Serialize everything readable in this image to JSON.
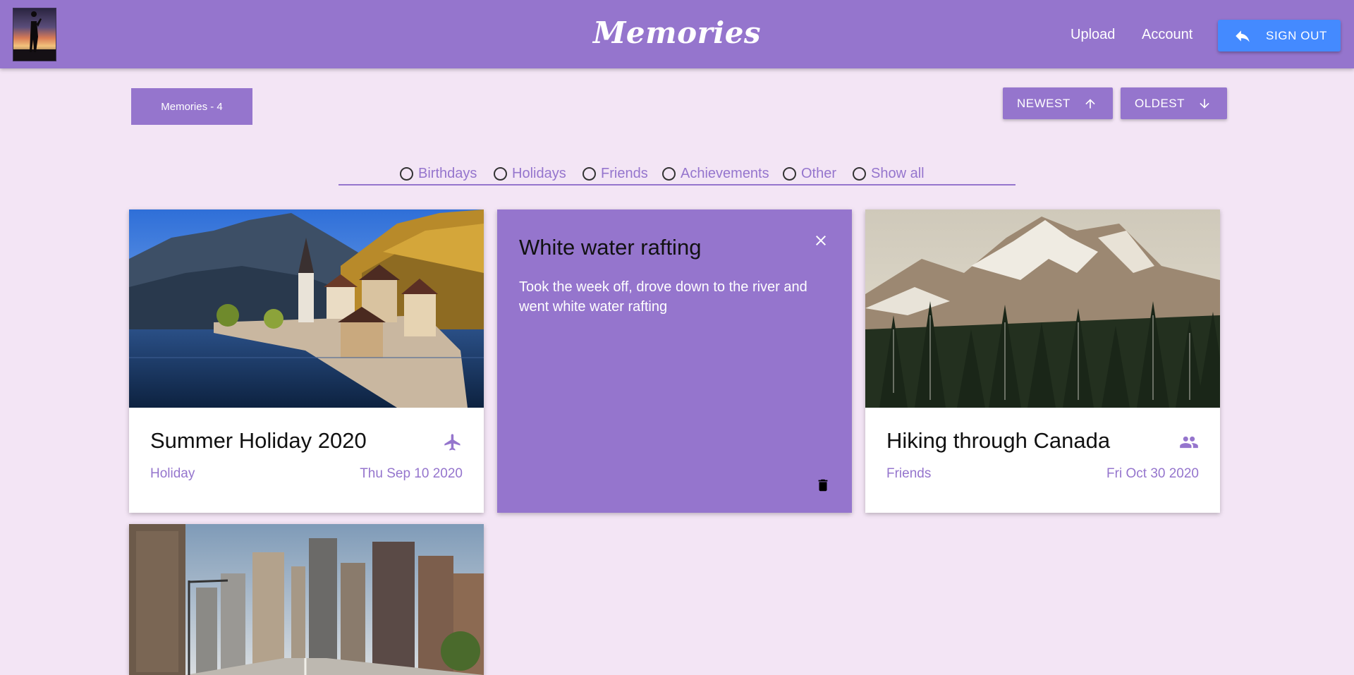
{
  "header": {
    "title": "Memories",
    "nav": {
      "upload": "Upload",
      "account": "Account"
    },
    "sign_out": "SIGN OUT",
    "avatar_alt": "avatar"
  },
  "toolbar": {
    "count_label": "Memories - 4",
    "sort_newest": "NEWEST",
    "sort_oldest": "OLDEST"
  },
  "filters": [
    {
      "label": "Birthdays",
      "checked": false
    },
    {
      "label": "Holidays",
      "checked": false
    },
    {
      "label": "Friends",
      "checked": false
    },
    {
      "label": "Achievements",
      "checked": false
    },
    {
      "label": "Other",
      "checked": false
    },
    {
      "label": "Show all",
      "checked": false
    }
  ],
  "cards": [
    {
      "title": "Summer Holiday 2020",
      "category": "Holiday",
      "date": "Thu Sep 10 2020",
      "icon": "airplane-icon",
      "image": "lakeside-village-photo"
    },
    {
      "title": "White water rafting",
      "description": "Took the week off, drove down to the river and went white water rafting",
      "expanded": true
    },
    {
      "title": "Hiking through Canada",
      "category": "Friends",
      "date": "Fri Oct 30 2020",
      "icon": "people-icon",
      "image": "snowy-mountain-forest-photo"
    },
    {
      "title": "",
      "image": "city-street-photo"
    }
  ],
  "colors": {
    "primary": "#9575cd",
    "background": "#f3e5f5",
    "accent": "#448aff"
  }
}
